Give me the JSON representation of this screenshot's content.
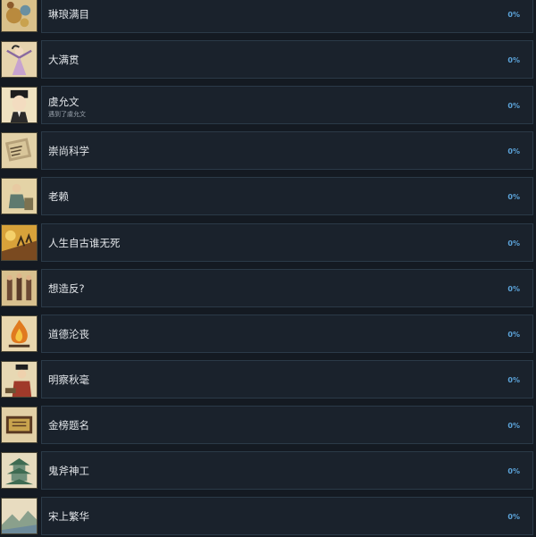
{
  "achievements": [
    {
      "title": "琳琅满目",
      "description": "",
      "percent": "0%",
      "icon": "jewelry-icon"
    },
    {
      "title": "大满贯",
      "description": "",
      "percent": "0%",
      "icon": "dancer-icon"
    },
    {
      "title": "虞允文",
      "description": "遇到了虞允文",
      "percent": "0%",
      "icon": "scholar-portrait-icon"
    },
    {
      "title": "崇尚科学",
      "description": "",
      "percent": "0%",
      "icon": "scroll-book-icon"
    },
    {
      "title": "老赖",
      "description": "",
      "percent": "0%",
      "icon": "seated-man-icon"
    },
    {
      "title": "人生自古谁无死",
      "description": "",
      "percent": "0%",
      "icon": "battle-scene-icon"
    },
    {
      "title": "想造反?",
      "description": "",
      "percent": "0%",
      "icon": "soldiers-icon"
    },
    {
      "title": "道德沦丧",
      "description": "",
      "percent": "0%",
      "icon": "fire-icon"
    },
    {
      "title": "明察秋毫",
      "description": "",
      "percent": "0%",
      "icon": "official-icon"
    },
    {
      "title": "金榜题名",
      "description": "",
      "percent": "0%",
      "icon": "plaque-icon"
    },
    {
      "title": "鬼斧神工",
      "description": "",
      "percent": "0%",
      "icon": "pagoda-icon"
    },
    {
      "title": "宋上繁华",
      "description": "",
      "percent": "0%",
      "icon": "landscape-icon"
    }
  ]
}
